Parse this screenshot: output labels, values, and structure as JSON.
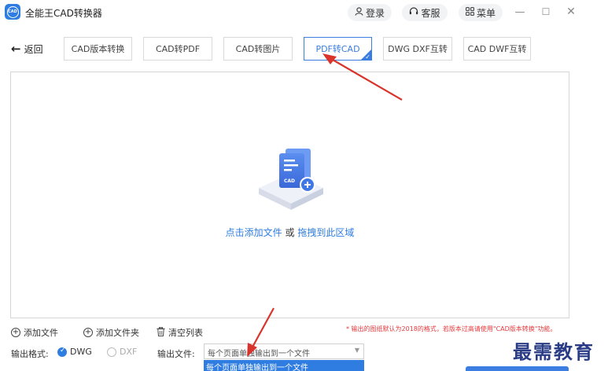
{
  "app": {
    "logo_text": "CAD",
    "title": "全能王CAD转换器"
  },
  "header": {
    "login": "登录",
    "service": "客服",
    "menu": "菜单"
  },
  "window": {
    "minimize": "—",
    "maximize": "☐",
    "close": "✕"
  },
  "nav": {
    "back_label": "返回"
  },
  "tabs": [
    {
      "label": "CAD版本转换",
      "active": false
    },
    {
      "label": "CAD转PDF",
      "active": false
    },
    {
      "label": "CAD转图片",
      "active": false
    },
    {
      "label": "PDF转CAD",
      "active": true
    },
    {
      "label": "DWG DXF互转",
      "active": false
    },
    {
      "label": "CAD DWF互转",
      "active": false
    }
  ],
  "dropzone": {
    "doc_badge": "CAD",
    "text_click": "点击添加文件",
    "text_or": " 或 ",
    "text_drag": "拖拽到此区域"
  },
  "actions": {
    "add_file": "添加文件",
    "add_folder": "添加文件夹",
    "clear_list": "清空列表"
  },
  "note": "* 输出的图纸默认为2018的格式，若版本过高请使用\"CAD版本转换\"功能。",
  "output": {
    "format_label": "输出格式:",
    "format_dwg": "DWG",
    "format_dxf": "DXF",
    "file_label": "输出文件:",
    "file_value": "每个页面单独输出到一个文件",
    "option_highlighted": "每个页面单独输出到一个文件"
  },
  "watermark": "最需教育",
  "colors": {
    "accent": "#2f7de1",
    "annotation_arrow": "#d9342b",
    "note": "#e4393c"
  }
}
